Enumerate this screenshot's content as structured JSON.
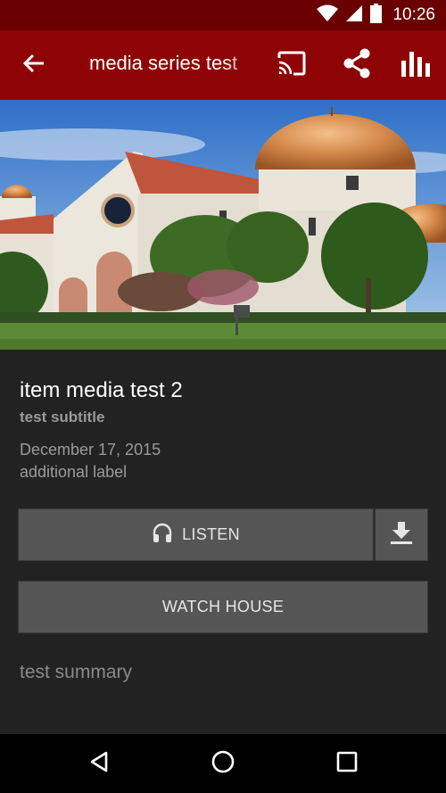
{
  "status_bar": {
    "time": "10:26",
    "icons": [
      "wifi-icon",
      "cell-signal-icon",
      "battery-icon"
    ]
  },
  "app_bar": {
    "title": "media series test",
    "back_icon": "arrow-left-icon",
    "actions": [
      "cast-icon",
      "share-icon",
      "bar-chart-icon"
    ]
  },
  "hero": {
    "image": "church building with copper domes under blue sky"
  },
  "item": {
    "title": "item media test 2",
    "subtitle": "test subtitle",
    "date": "December 17, 2015",
    "additional_label": "additional label",
    "summary": "test summary"
  },
  "buttons": {
    "listen_label": "LISTEN",
    "listen_icon": "headphones-icon",
    "download_icon": "download-icon",
    "watch_label": "WATCH HOUSE"
  },
  "nav_bar": {
    "icons": [
      "back-triangle-icon",
      "home-circle-icon",
      "recents-square-icon"
    ]
  },
  "colors": {
    "status_bar": "#6a0000",
    "app_bar": "#8e0404",
    "background": "#222222",
    "button": "#555555",
    "secondary_text": "#9a9a9a"
  }
}
